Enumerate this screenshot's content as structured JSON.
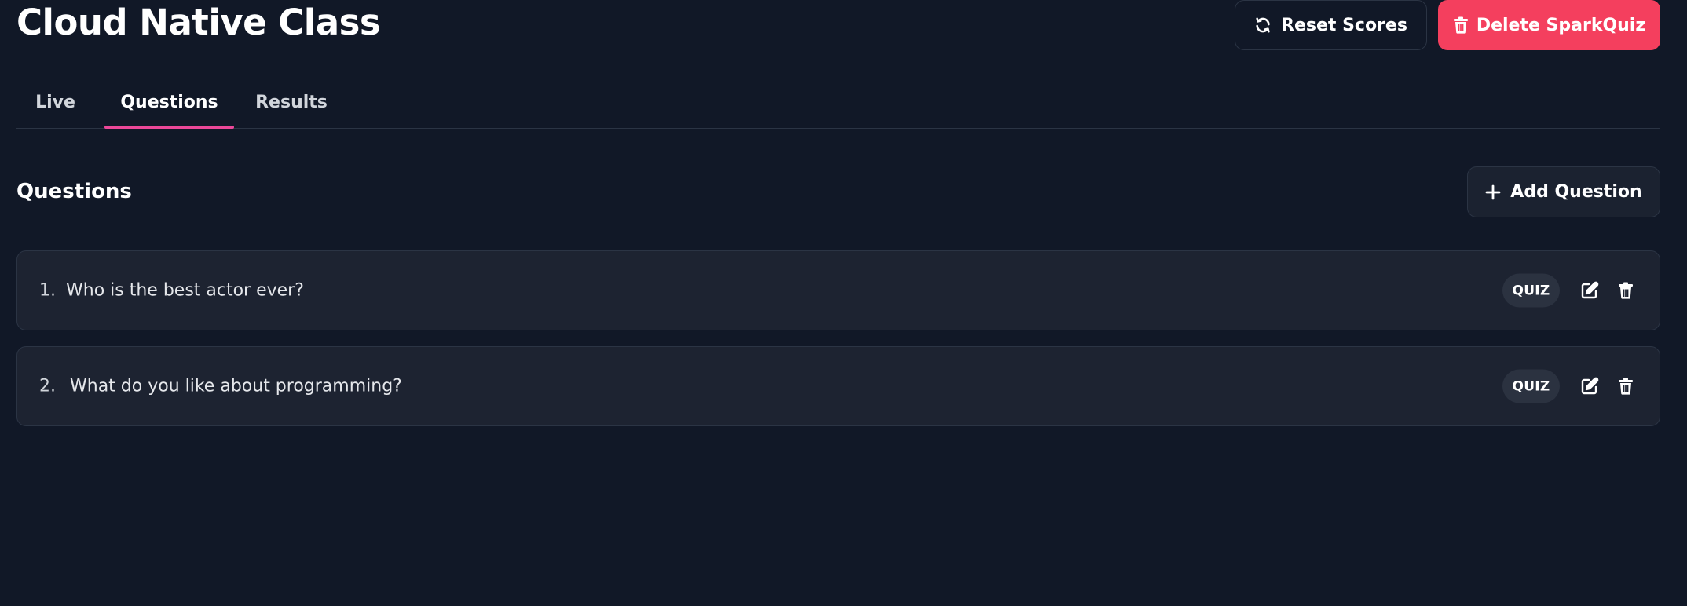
{
  "header": {
    "title": "Cloud Native Class",
    "reset_label": "Reset Scores",
    "delete_label": "Delete SparkQuiz",
    "reset_icon": "refresh-icon",
    "delete_icon": "trash-icon"
  },
  "tabs": [
    {
      "label": "Live",
      "active": false
    },
    {
      "label": "Questions",
      "active": true
    },
    {
      "label": "Results",
      "active": false
    }
  ],
  "questions_section": {
    "title": "Questions",
    "add_label": "Add Question",
    "add_icon": "plus-icon"
  },
  "questions": [
    {
      "number": "1.",
      "text": "Who is the best actor ever?",
      "type": "QUIZ"
    },
    {
      "number": "2.",
      "text": "What do you like about programming?",
      "type": "QUIZ"
    }
  ],
  "colors": {
    "background": "#111827",
    "card": "#1d2331",
    "accent_pink": "#ec4899",
    "danger": "#f43f5e"
  }
}
